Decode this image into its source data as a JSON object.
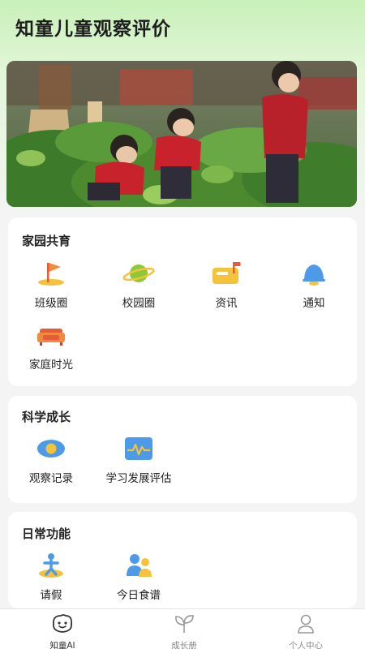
{
  "header": {
    "title": "知童儿童观察评价"
  },
  "banner": {
    "alt": "children-in-garden-photo"
  },
  "sections": {
    "home_school": {
      "title": "家园共育",
      "items": [
        {
          "label": "班级圈",
          "icon": "flag-icon"
        },
        {
          "label": "校园圈",
          "icon": "planet-icon"
        },
        {
          "label": "资讯",
          "icon": "mailbox-icon"
        },
        {
          "label": "通知",
          "icon": "bell-icon"
        },
        {
          "label": "家庭时光",
          "icon": "sofa-icon"
        }
      ]
    },
    "growth": {
      "title": "科学成长",
      "items": [
        {
          "label": "观察记录",
          "icon": "eye-icon"
        },
        {
          "label": "学习发展评估",
          "icon": "chart-monitor-icon"
        }
      ]
    },
    "daily": {
      "title": "日常功能",
      "items": [
        {
          "label": "请假",
          "icon": "person-leave-icon"
        },
        {
          "label": "今日食谱",
          "icon": "meal-people-icon"
        }
      ]
    }
  },
  "tabbar": {
    "tabs": [
      {
        "label": "知童AI",
        "icon": "kid-face-icon",
        "active": true
      },
      {
        "label": "成长册",
        "icon": "sprout-icon",
        "active": false
      },
      {
        "label": "个人中心",
        "icon": "user-icon",
        "active": false
      }
    ]
  },
  "colors": {
    "accent_orange": "#f08a3c",
    "accent_green": "#8bc93b",
    "accent_yellow": "#f5c33b",
    "accent_blue": "#4d9be8",
    "accent_red": "#e85a3c"
  }
}
